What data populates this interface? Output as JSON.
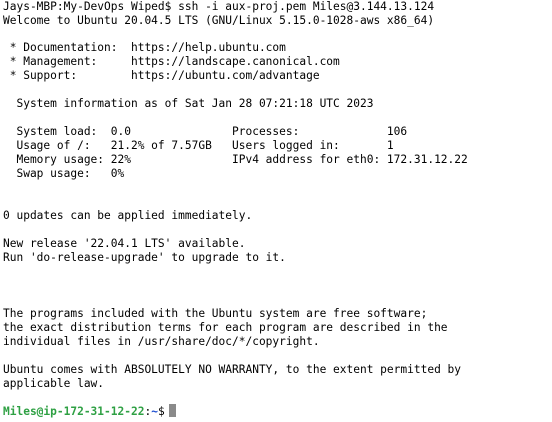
{
  "terminal": {
    "lines": [
      "Jays-MBP:My-DevOps Wiped$ ssh -i aux-proj.pem Miles@3.144.13.124",
      "Welcome to Ubuntu 20.04.5 LTS (GNU/Linux 5.15.0-1028-aws x86_64)",
      "",
      " * Documentation:  https://help.ubuntu.com",
      " * Management:     https://landscape.canonical.com",
      " * Support:        https://ubuntu.com/advantage",
      "",
      "  System information as of Sat Jan 28 07:21:18 UTC 2023",
      "",
      "  System load:  0.0               Processes:             106",
      "  Usage of /:   21.2% of 7.57GB   Users logged in:       1",
      "  Memory usage: 22%               IPv4 address for eth0: 172.31.12.22",
      "  Swap usage:   0%",
      "",
      "",
      "0 updates can be applied immediately.",
      "",
      "New release '22.04.1 LTS' available.",
      "Run 'do-release-upgrade' to upgrade to it.",
      "",
      "",
      "",
      "The programs included with the Ubuntu system are free software;",
      "the exact distribution terms for each program are described in the",
      "individual files in /usr/share/doc/*/copyright.",
      "",
      "Ubuntu comes with ABSOLUTELY NO WARRANTY, to the extent permitted by",
      "applicable law.",
      ""
    ],
    "prompt": {
      "user_host": "Miles@ip-172-31-12-22",
      "separator": ":",
      "path": "~",
      "symbol": "$"
    }
  },
  "colors": {
    "background": "#ffffff",
    "text": "#000000",
    "prompt_user": "#2ea043",
    "prompt_path": "#1f4fd1",
    "cursor": "#8a8a8a"
  }
}
